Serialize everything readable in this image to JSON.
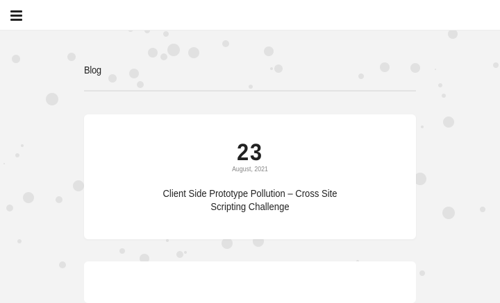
{
  "header": {
    "menu_icon": "hamburger-menu-icon"
  },
  "blog": {
    "section_title": "Blog",
    "posts": [
      {
        "day": "23",
        "date": "August, 2021",
        "title": "Client Side Prototype Pollution – Cross Site Scripting Challenge"
      }
    ]
  },
  "colors": {
    "background": "#f3f3f3",
    "card": "#ffffff",
    "dots": "#e1e1e1",
    "text": "#222222",
    "muted": "#888888"
  }
}
